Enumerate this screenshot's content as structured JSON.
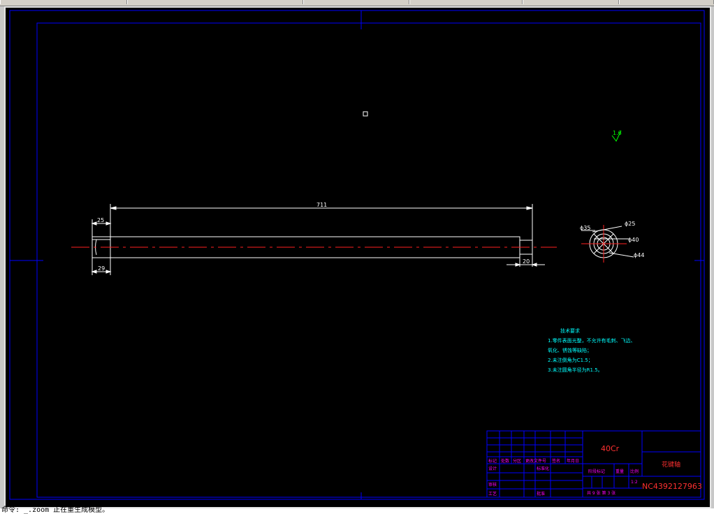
{
  "drawing": {
    "dimensions": {
      "overall_length": "711",
      "left_width_top": "25",
      "left_width_bottom": "29",
      "right_step": "20",
      "diameters": [
        "ɸ35",
        "ɸ25",
        "ɸ40",
        "ɸ44"
      ]
    },
    "roughness": "1.6",
    "tech_notes": {
      "heading": "技术要求",
      "lines": [
        "1.零件表面光整，不允许有毛刺、飞边、",
        "  氧化、锈蚀等缺陷；",
        "2.未注倒角为C1.5；",
        "3.未注圆角半径为R1.5。"
      ]
    },
    "title_block": {
      "material": "40Cr",
      "part_name": "花键轴",
      "drawing_number": "NC4392127963",
      "labels": {
        "mark": "标记",
        "count": "处数",
        "zone": "分区",
        "change_doc": "更改文件号",
        "signature": "签名",
        "date": "年月日",
        "design": "设计",
        "standardize": "标准化",
        "stage_mark": "阶段标记",
        "weight": "重量",
        "scale": "比例",
        "review": "审核",
        "process": "工艺",
        "approve": "批准",
        "sheets": "共 9 张 第 3 张"
      },
      "scale_value": "1:2"
    },
    "colors": {
      "background": "#000000",
      "frame": "#0000ff",
      "part_line": "#ffffff",
      "centerline": "#ff2020",
      "notes": "#00ffff",
      "title_text": "#ff00ff",
      "material_text": "#ff3030",
      "roughness": "#00ff00"
    }
  },
  "status": {
    "command_line": "命令: _.zoom 正在重生成模型。"
  }
}
